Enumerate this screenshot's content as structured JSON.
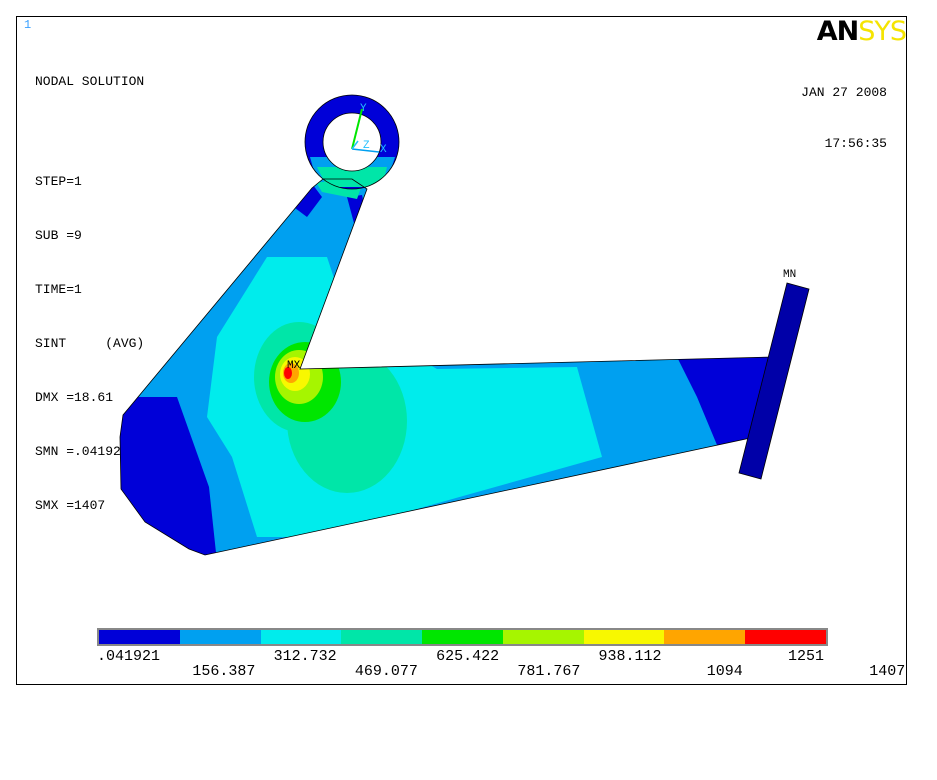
{
  "window_number": "1",
  "title": "NODAL SOLUTION",
  "info": [
    "STEP=1",
    "SUB =9",
    "TIME=1",
    "SINT     (AVG)",
    "DMX =18.61",
    "SMN =.041921",
    "SMX =1407"
  ],
  "logo": {
    "part1": "AN",
    "part2": "SYS"
  },
  "date": "JAN 27 2008",
  "time": "17:56:35",
  "markers": {
    "max": "MX",
    "min": "MN"
  },
  "axes": {
    "y": "Y",
    "z": "Z",
    "x": "X"
  },
  "legend": {
    "colors": [
      "#0000d8",
      "#00a0f0",
      "#00ecec",
      "#00e6a8",
      "#00e600",
      "#a6f500",
      "#f8f800",
      "#ffa500",
      "#ff0000"
    ],
    "labels_top": [
      ".041921",
      "312.732",
      "625.422",
      "938.112",
      "1251"
    ],
    "labels_bottom": [
      "156.387",
      "469.077",
      "781.767",
      "1094",
      "1407"
    ]
  }
}
